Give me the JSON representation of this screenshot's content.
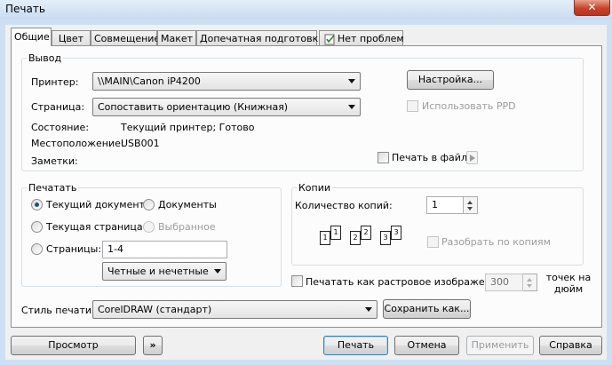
{
  "window": {
    "title": "Печать",
    "close_label": "✕"
  },
  "tabs": [
    {
      "label": "Общие",
      "active": true
    },
    {
      "label": "Цвет"
    },
    {
      "label": "Совмещение"
    },
    {
      "label": "Макет"
    },
    {
      "label": "Допечатная подготовка"
    },
    {
      "label": "Нет проблем",
      "icon": "checklist-icon"
    }
  ],
  "output": {
    "title": "Вывод",
    "printer_label": "Принтер:",
    "printer_value": "\\\\MAIN\\Canon iP4200",
    "setup_button": "Настройка...",
    "page_label": "Страница:",
    "page_value": "Сопоставить ориентацию (Книжная)",
    "use_ppd": "Использовать PPD",
    "status_label": "Состояние:",
    "status_value": "Текущий принтер; Готово",
    "location_label": "Местоположение:",
    "location_value": "USB001",
    "notes_label": "Заметки:",
    "print_to_file": "Печать в файл"
  },
  "print_range": {
    "title": "Печатать",
    "current_document": "Текущий документ",
    "documents": "Документы",
    "current_page": "Текущая страница",
    "selection": "Выбранное",
    "pages": "Страницы:",
    "pages_value": "1-4",
    "odd_even_value": "Четные и нечетные"
  },
  "copies": {
    "title": "Копии",
    "count_label": "Количество копий:",
    "count_value": "1",
    "collate": "Разобрать по копиям",
    "page_numbers": [
      "1",
      "1",
      "2",
      "2",
      "3",
      "3"
    ]
  },
  "raster": {
    "label": "Печатать как растровое изображение:",
    "dpi_value": "300",
    "dpi_unit": "точек на дюйм"
  },
  "style": {
    "label": "Стиль печати:",
    "value": "CorelDRAW (стандарт)",
    "save_as_button": "Сохранить как..."
  },
  "buttons": {
    "preview": "Просмотр",
    "expand": "»",
    "print": "Печать",
    "cancel": "Отмена",
    "apply": "Применить",
    "help": "Справка"
  }
}
